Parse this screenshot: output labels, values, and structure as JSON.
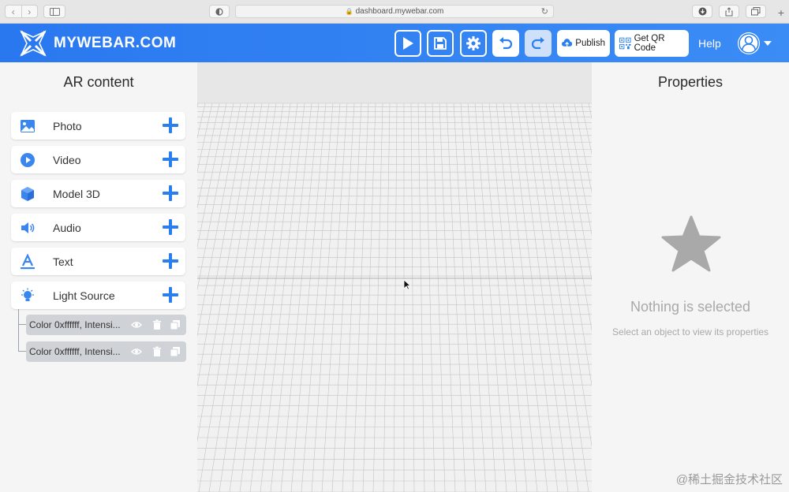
{
  "browser": {
    "url": "dashboard.mywebar.com"
  },
  "header": {
    "logo_text": "MYWEBAR.COM",
    "publish_label": "Publish",
    "qr_label": "Get QR Code",
    "help_label": "Help",
    "accent": "#2a7ff0"
  },
  "left_panel": {
    "title": "AR content",
    "items": [
      {
        "label": "Photo",
        "icon": "photo-icon"
      },
      {
        "label": "Video",
        "icon": "video-play-icon"
      },
      {
        "label": "Model 3D",
        "icon": "cube-icon"
      },
      {
        "label": "Audio",
        "icon": "speaker-icon"
      },
      {
        "label": "Text",
        "icon": "text-icon"
      },
      {
        "label": "Light Source",
        "icon": "lightbulb-icon"
      }
    ],
    "lights": [
      {
        "label": "Color 0xffffff, Intensi..."
      },
      {
        "label": "Color 0xffffff, Intensi..."
      }
    ]
  },
  "right_panel": {
    "title": "Properties",
    "empty_title": "Nothing is selected",
    "empty_subtitle": "Select an object to view its properties"
  },
  "watermark": "@稀土掘金技术社区"
}
